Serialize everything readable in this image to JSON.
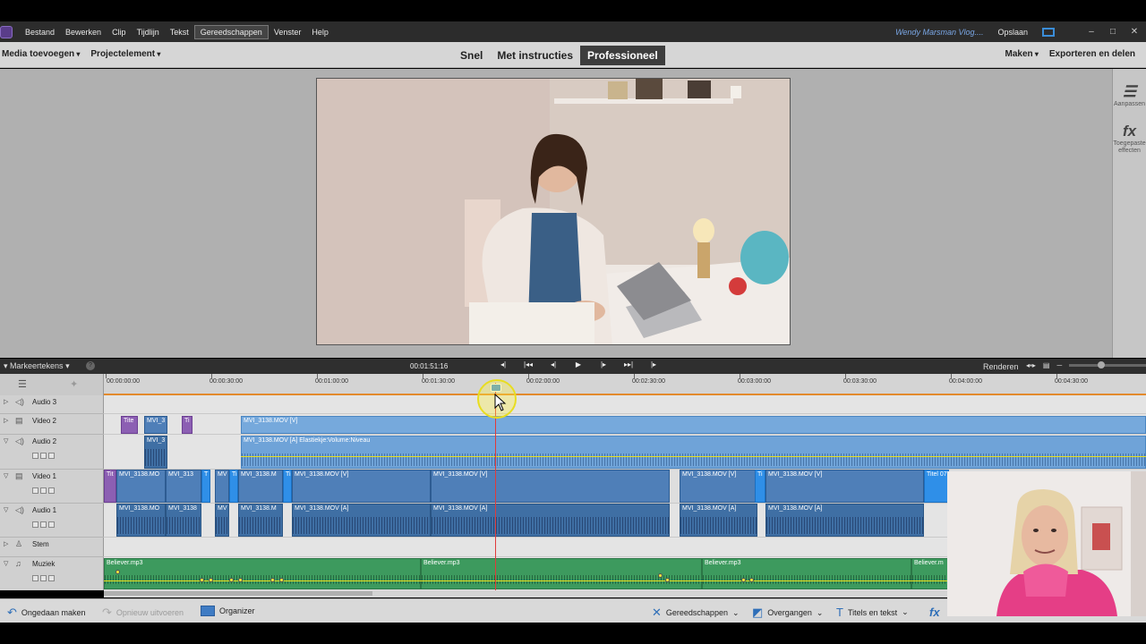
{
  "menu": {
    "items": [
      "Bestand",
      "Bewerken",
      "Clip",
      "Tijdlijn",
      "Tekst",
      "Gereedschappen",
      "Venster",
      "Help"
    ],
    "active": "Gereedschappen",
    "user": "Wendy Marsman Vlog....",
    "save": "Opslaan"
  },
  "modebar": {
    "media": "Media toevoegen",
    "project": "Projectelement",
    "tabs": [
      "Snel",
      "Met instructies",
      "Professioneel"
    ],
    "active_tab": "Professioneel",
    "make": "Maken",
    "export": "Exporteren en delen"
  },
  "right_panel": {
    "adjust": "Aanpassen",
    "effects": "Toegepaste effecten"
  },
  "timeline": {
    "markers": "Markeertekens",
    "timecode": "00:01:51:16",
    "render": "Renderen",
    "ruler": [
      "00:00:00:00",
      "00:00:30:00",
      "00:01:00:00",
      "00:01:30:00",
      "00:02:00:00",
      "00:02:30:00",
      "00:03:00:00",
      "00:03:30:00",
      "00:04:00:00",
      "00:04:30:00"
    ],
    "tracks": [
      "Audio 3",
      "Video 2",
      "Audio 2",
      "Video 1",
      "Audio 1",
      "Stem",
      "Muziek"
    ],
    "clips": {
      "v2_main": "MVI_3138.MOV [V]",
      "a2_main": "MVI_3138.MOV [A] Elastiekje:Volume:Niveau",
      "v2_a": "Tite",
      "v2_b": "MVI_3",
      "v2_c": "Ti",
      "a2_b": "MVI_3",
      "v1": [
        "Tit",
        "MVI_3138.MO",
        "MVI_313",
        "T",
        "MV",
        "Ti",
        "MVI_3138.M",
        "Ti",
        "MVI_3138.MOV [V]",
        "MVI_3138.MOV [V]",
        "MVI_3138.MOV [V]",
        "MVI_3138.MOV [V]",
        "Ti",
        "Titel 07"
      ],
      "a1": [
        "MVI_3138.MO",
        "MVI_3138",
        "MV",
        "MVI_3138.M",
        "MVI_3138.MOV [A]",
        "MVI_3138.MOV [A]",
        "MVI_3138.MOV [A]",
        "MVI_3138.MOV [A]"
      ],
      "music": [
        "Believer.mp3",
        "Believer.mp3",
        "Believer.mp3",
        "Believer.m"
      ]
    }
  },
  "bottom": {
    "undo": "Ongedaan maken",
    "redo": "Opnieuw uitvoeren",
    "organizer": "Organizer",
    "tools": "Gereedschappen",
    "transitions": "Overgangen",
    "titles": "Titels en tekst"
  }
}
